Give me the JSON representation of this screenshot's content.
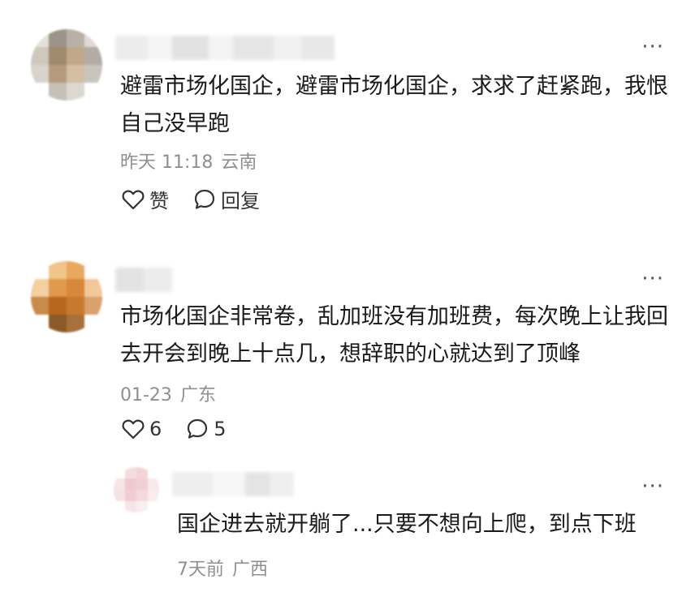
{
  "comments": [
    {
      "text": "避雷市场化国企，避雷市场化国企，求求了赶紧跑，我恨自己没早跑",
      "time": "昨天 11:18",
      "location": "云南",
      "like_label": "赞",
      "reply_label": "回复"
    },
    {
      "text": "市场化国企非常卷，乱加班没有加班费，每次晚上让我回去开会到晚上十点几，想辞职的心就达到了顶峰",
      "time": "01-23",
      "location": "广东",
      "like_count": "6",
      "reply_count": "5"
    }
  ],
  "reply": {
    "text": "国企进去就开躺了...只要不想向上爬，到点下班",
    "time": "7天前",
    "location": "广西"
  },
  "more_glyph": "···",
  "icons": [
    "heart-icon",
    "comment-bubble-icon",
    "more-icon"
  ]
}
